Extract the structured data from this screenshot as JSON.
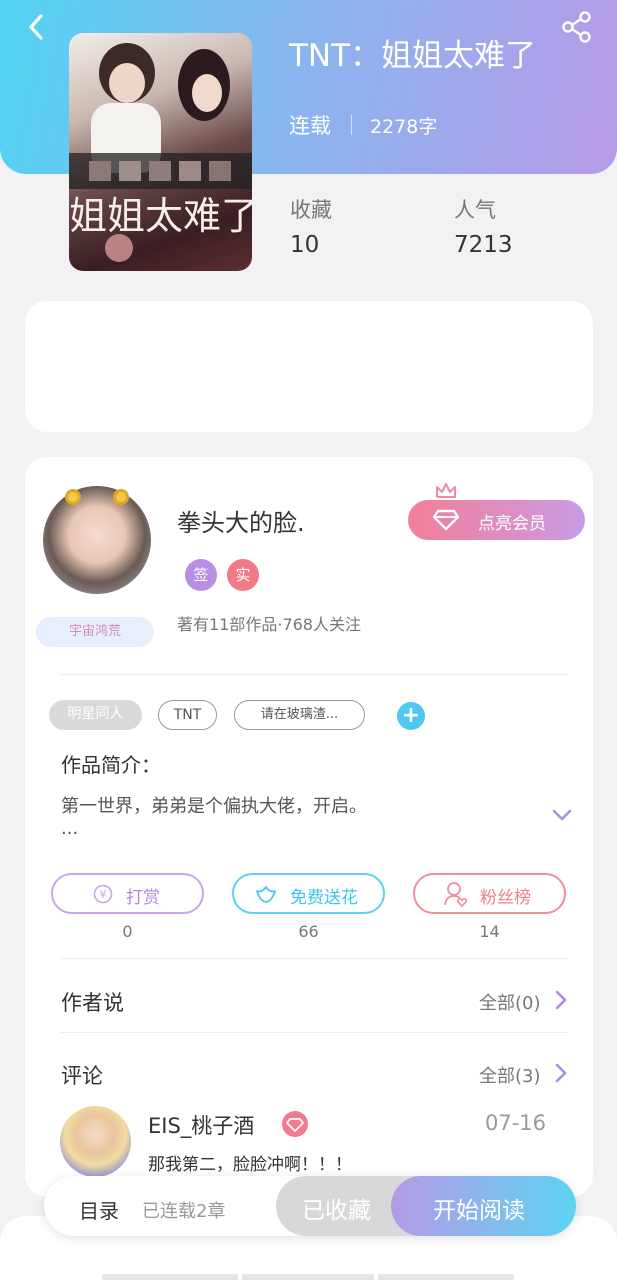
{
  "book": {
    "title": "TNT：姐姐太难了",
    "status": "连载",
    "word_count": "2278字",
    "cover_title": "姐姐太难了"
  },
  "stats": {
    "favorites_label": "收藏",
    "favorites_value": "10",
    "popularity_label": "人气",
    "popularity_value": "7213"
  },
  "author": {
    "name": "拳头大的脸.",
    "badge_signed": "签",
    "badge_verified": "实",
    "avatar_badge": "宇宙鸿荒",
    "stats": "著有11部作品·768人关注",
    "vip_button": "点亮会员"
  },
  "tags": [
    "明星同人",
    "TNT",
    "请在玻璃渣..."
  ],
  "intro": {
    "label": "作品简介：",
    "text": "第一世界，弟弟是个偏执大佬，开启。",
    "ellipsis": "..."
  },
  "actions": [
    {
      "label": "打赏",
      "count": "0",
      "icon": "yuan-icon"
    },
    {
      "label": "免费送花",
      "count": "66",
      "icon": "flower-icon"
    },
    {
      "label": "粉丝榜",
      "count": "14",
      "icon": "fan-icon"
    }
  ],
  "author_says": {
    "title": "作者说",
    "link": "全部(0)"
  },
  "comments": {
    "title": "评论",
    "link": "全部(3)",
    "first": {
      "user": "EIS_桃子酒",
      "date": "07-16",
      "text": "那我第二，脸脸冲啊！！！"
    }
  },
  "bottom_bar": {
    "toc": "目录",
    "chapters": "已连载2章",
    "collected": "已收藏",
    "read": "开始阅读"
  },
  "colors": {
    "header_start": "#52d3f3",
    "header_end": "#b79ae8",
    "accent_pink": "#f47a8f",
    "accent_purple": "#b08ae0",
    "accent_cyan": "#4fc8ef"
  }
}
